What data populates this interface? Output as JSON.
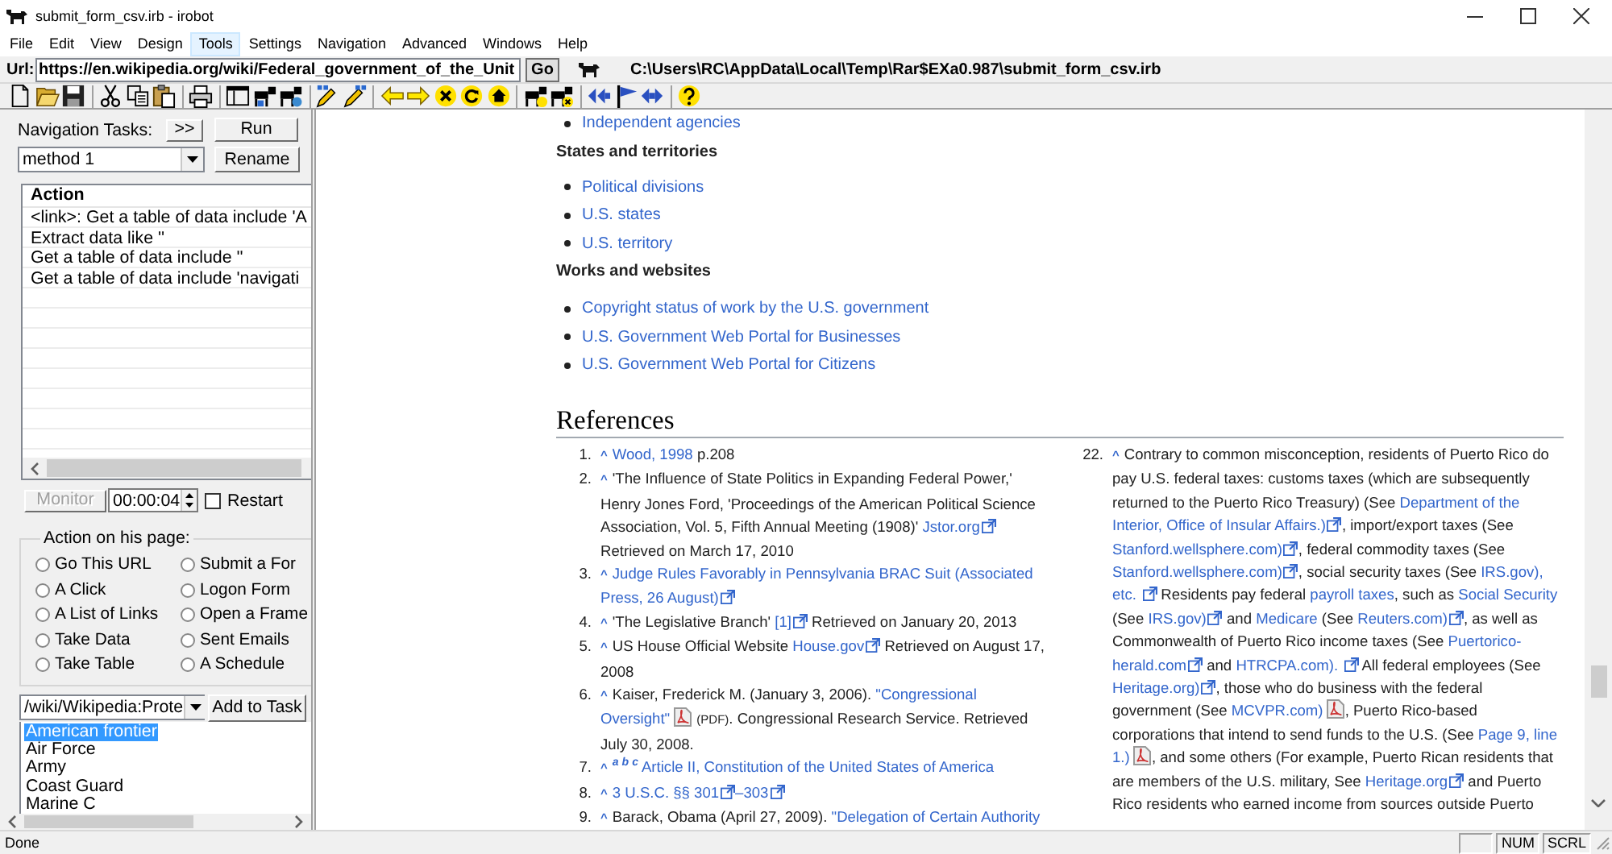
{
  "window": {
    "title": "submit_form_csv.irb - irobot"
  },
  "menu": [
    {
      "label": "File",
      "selected": false
    },
    {
      "label": "Edit",
      "selected": false
    },
    {
      "label": "View",
      "selected": false
    },
    {
      "label": "Design",
      "selected": false
    },
    {
      "label": "Tools",
      "selected": true
    },
    {
      "label": "Settings",
      "selected": false
    },
    {
      "label": "Navigation",
      "selected": false
    },
    {
      "label": "Advanced",
      "selected": false
    },
    {
      "label": "Windows",
      "selected": false
    },
    {
      "label": "Help",
      "selected": false
    }
  ],
  "address_bar": {
    "label": "Url:",
    "value": "https://en.wikipedia.org/wiki/Federal_government_of_the_Unit",
    "go_button": "Go",
    "file_path": "C:\\Users\\RC\\AppData\\Local\\Temp\\Rar$EXa0.987\\submit_form_csv.irb"
  },
  "tasks_panel": {
    "label": "Navigation Tasks:",
    "expand_button": ">>",
    "run_button": "Run",
    "method": "method 1",
    "rename_button": "Rename",
    "actions": {
      "column": "Action",
      "rows": [
        "<link>: Get a table of data include 'A",
        "Extract data like ''",
        "Get a table of data include ''",
        "Get a table of data include 'navigati"
      ]
    },
    "monitor_button": {
      "label": "Monitor",
      "disabled": true
    },
    "interval": "00:00:04",
    "restart": {
      "label": "Restart",
      "checked": false
    },
    "action_group": {
      "title": "Action on his page:",
      "options": [
        {
          "label": "Go This URL",
          "selected": false
        },
        {
          "label": "Submit a For",
          "selected": false
        },
        {
          "label": "A Click",
          "selected": false
        },
        {
          "label": "Logon Form",
          "selected": false
        },
        {
          "label": "A List of Links",
          "selected": false
        },
        {
          "label": "Open a Frame",
          "selected": false
        },
        {
          "label": "Take Data",
          "selected": false
        },
        {
          "label": "Sent Emails",
          "selected": false
        },
        {
          "label": "Take Table",
          "selected": false
        },
        {
          "label": "A Schedule",
          "selected": false
        }
      ]
    },
    "link_select": "/wiki/Wikipedia:Prote",
    "add_button": "Add to Task",
    "links": [
      {
        "label": "American frontier",
        "selected": true
      },
      {
        "label": "Air Force",
        "selected": false
      },
      {
        "label": "Army",
        "selected": false
      },
      {
        "label": "Coast Guard",
        "selected": false
      },
      {
        "label": "Marine C",
        "selected": false
      }
    ]
  },
  "page": {
    "sections": [
      {
        "links": [
          "Independent agencies"
        ]
      },
      {
        "heading": "States and territories",
        "links": [
          "Political divisions",
          "U.S. states",
          "U.S. territory"
        ]
      },
      {
        "heading": "Works and websites",
        "links": [
          "Copyright status of work by the U.S. government",
          "U.S. Government Web Portal for Businesses",
          "U.S. Government Web Portal for Citizens"
        ]
      }
    ],
    "references": {
      "title": "References",
      "columns": [
        [
          {
            "number": "1.",
            "backlink": "^",
            "segments": [
              {
                "kind": "link",
                "text": "Wood, 1998"
              },
              {
                "kind": "text",
                "text": " p.208"
              }
            ]
          },
          {
            "number": "2.",
            "backlink": "^",
            "segments": [
              {
                "kind": "text",
                "text": "'The Influence of State Politics in Expanding Federal Power,' Henry Jones Ford, 'Proceedings of the American Political Science Association, Vol. 5, Fifth Annual Meeting (1908)' "
              },
              {
                "kind": "link",
                "text": "Jstor.org"
              },
              {
                "kind": "ext"
              },
              {
                "kind": "text",
                "text": " Retrieved on March 17, 2010"
              }
            ]
          },
          {
            "number": "3.",
            "backlink": "^",
            "segments": [
              {
                "kind": "link",
                "text": "Judge Rules Favorably in Pennsylvania BRAC Suit (Associated "
              },
              {
                "kind": "link",
                "text": "Press, 26 August)"
              },
              {
                "kind": "ext"
              }
            ]
          },
          {
            "number": "4.",
            "backlink": "^",
            "segments": [
              {
                "kind": "text",
                "text": "'The Legislative Branch' "
              },
              {
                "kind": "link",
                "text": "[1]"
              },
              {
                "kind": "ext"
              },
              {
                "kind": "text",
                "text": " Retrieved on January 20, 2013"
              }
            ]
          },
          {
            "number": "5.",
            "backlink": "^",
            "segments": [
              {
                "kind": "text",
                "text": "US House Official Website "
              },
              {
                "kind": "link",
                "text": "House.gov"
              },
              {
                "kind": "ext"
              },
              {
                "kind": "text",
                "text": " Retrieved on August 17, 2008"
              }
            ]
          },
          {
            "number": "6.",
            "backlink": "^",
            "segments": [
              {
                "kind": "text",
                "text": "Kaiser, Frederick M. (January 3, 2006). "
              },
              {
                "kind": "link",
                "text": "\"Congressional "
              },
              {
                "kind": "link",
                "text": "Oversight\" "
              },
              {
                "kind": "pdf"
              },
              {
                "kind": "small",
                "text": "(PDF)"
              },
              {
                "kind": "text",
                "text": ". Congressional Research Service. Retrieved July 30, 2008."
              }
            ]
          },
          {
            "number": "7.",
            "backlink": "^",
            "segments": [
              {
                "kind": "sup",
                "text": "a"
              },
              {
                "kind": "sup",
                "text": "b"
              },
              {
                "kind": "sup",
                "text": "c"
              },
              {
                "kind": "link",
                "text": "Article II, Constitution of the United States of America"
              }
            ]
          },
          {
            "number": "8.",
            "backlink": "^",
            "segments": [
              {
                "kind": "link",
                "text": "3 U.S.C. §§ 301"
              },
              {
                "kind": "ext"
              },
              {
                "kind": "link",
                "text": "–303"
              },
              {
                "kind": "ext"
              }
            ]
          },
          {
            "number": "9.",
            "backlink": "^",
            "segments": [
              {
                "kind": "text",
                "text": "Barack, Obama (April 27, 2009). "
              },
              {
                "kind": "link",
                "text": "\"Delegation of Certain Authority"
              }
            ]
          }
        ],
        [
          {
            "number": "22.",
            "backlink": "^",
            "segments": [
              {
                "kind": "text",
                "text": "Contrary to common misconception, residents of Puerto Rico do pay U.S. federal taxes: customs taxes (which are subsequently returned to the Puerto Rico Treasury) (See "
              },
              {
                "kind": "link",
                "text": "Department of the "
              },
              {
                "kind": "link",
                "text": "Interior, Office of Insular Affairs.)"
              },
              {
                "kind": "ext"
              },
              {
                "kind": "text",
                "text": ", import/export taxes (See "
              },
              {
                "kind": "link",
                "text": "Stanford.wellsphere.com)"
              },
              {
                "kind": "ext"
              },
              {
                "kind": "text",
                "text": ", federal commodity taxes (See "
              },
              {
                "kind": "link",
                "text": "Stanford.wellsphere.com)"
              },
              {
                "kind": "ext"
              },
              {
                "kind": "text",
                "text": ", social security taxes (See "
              },
              {
                "kind": "link",
                "text": "IRS.gov), "
              },
              {
                "kind": "link",
                "text": "etc. "
              },
              {
                "kind": "ext"
              },
              {
                "kind": "text",
                "text": " Residents pay federal "
              },
              {
                "kind": "link",
                "text": "payroll taxes"
              },
              {
                "kind": "text",
                "text": ", such as "
              },
              {
                "kind": "link",
                "text": "Social Security"
              },
              {
                "kind": "text",
                "text": " (See "
              },
              {
                "kind": "link",
                "text": "IRS.gov)"
              },
              {
                "kind": "ext"
              },
              {
                "kind": "text",
                "text": " and "
              },
              {
                "kind": "link",
                "text": "Medicare"
              },
              {
                "kind": "text",
                "text": " (See "
              },
              {
                "kind": "link",
                "text": "Reuters.com)"
              },
              {
                "kind": "ext"
              },
              {
                "kind": "text",
                "text": ", as well as Commonwealth of Puerto Rico income taxes (See "
              },
              {
                "kind": "link",
                "text": "Puertorico-"
              },
              {
                "kind": "link",
                "text": "herald.com"
              },
              {
                "kind": "ext"
              },
              {
                "kind": "text",
                "text": " and "
              },
              {
                "kind": "link",
                "text": "HTRCPA.com). "
              },
              {
                "kind": "ext"
              },
              {
                "kind": "text",
                "text": " All federal employees (See "
              },
              {
                "kind": "link",
                "text": "Heritage.org)"
              },
              {
                "kind": "ext"
              },
              {
                "kind": "text",
                "text": ", those who do business with the federal government (See "
              },
              {
                "kind": "link",
                "text": "MCVPR.com) "
              },
              {
                "kind": "pdf"
              },
              {
                "kind": "text",
                "text": ", Puerto Rico-based corporations that intend to send funds to the U.S. (See "
              },
              {
                "kind": "link",
                "text": "Page 9, line "
              },
              {
                "kind": "link",
                "text": "1.) "
              },
              {
                "kind": "pdf"
              },
              {
                "kind": "text",
                "text": ", and some others (For example, Puerto Rican residents that are members of the U.S. military, See "
              },
              {
                "kind": "link",
                "text": "Heritage.org"
              },
              {
                "kind": "ext"
              },
              {
                "kind": "text",
                "text": " and Puerto Rico residents who earned income from sources outside Puerto"
              }
            ]
          }
        ]
      ]
    }
  },
  "status_bar": {
    "text": "Done",
    "indicators": [
      "NUM",
      "SCRL"
    ]
  }
}
